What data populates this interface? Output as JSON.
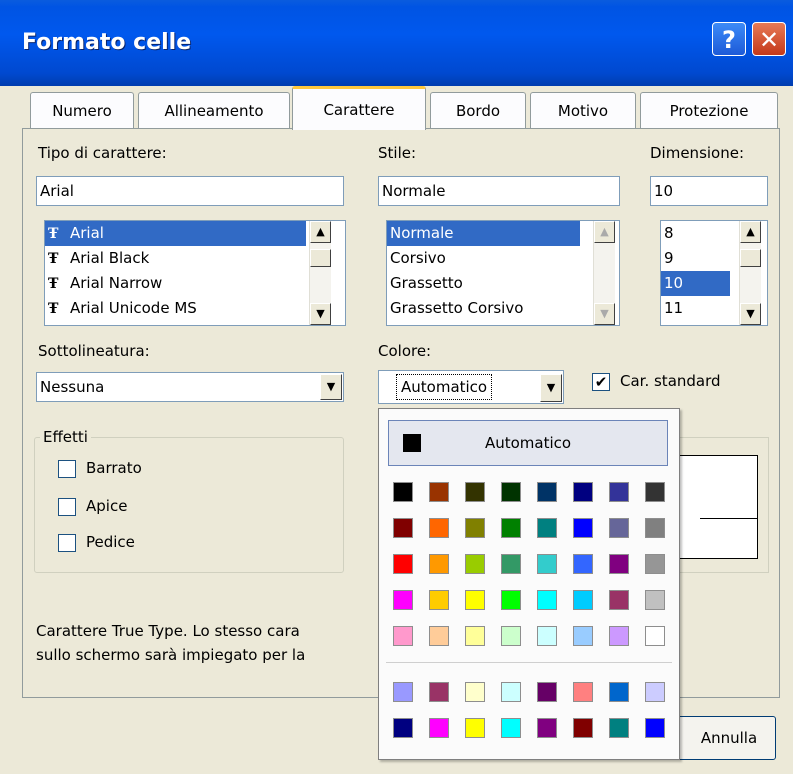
{
  "window": {
    "title": "Formato celle",
    "help_label": "?",
    "close_label": "✕"
  },
  "tabs": [
    {
      "label": "Numero"
    },
    {
      "label": "Allineamento"
    },
    {
      "label": "Carattere"
    },
    {
      "label": "Bordo"
    },
    {
      "label": "Motivo"
    },
    {
      "label": "Protezione"
    }
  ],
  "font": {
    "label": "Tipo di carattere:",
    "value": "Arial",
    "options": [
      "Arial",
      "Arial Black",
      "Arial Narrow",
      "Arial Unicode MS"
    ],
    "selected": "Arial",
    "option_icon": "truetype-icon"
  },
  "style": {
    "label": "Stile:",
    "value": "Normale",
    "options": [
      "Normale",
      "Corsivo",
      "Grassetto",
      "Grassetto Corsivo"
    ],
    "selected": "Normale"
  },
  "size": {
    "label": "Dimensione:",
    "value": "10",
    "options": [
      "8",
      "9",
      "10",
      "11"
    ],
    "selected": "10"
  },
  "underline": {
    "label": "Sottolineatura:",
    "value": "Nessuna"
  },
  "color": {
    "label": "Colore:",
    "value": "Automatico"
  },
  "standard_font": {
    "label": "Car. standard",
    "checked": true
  },
  "effects": {
    "legend": "Effetti",
    "items": [
      {
        "label": "Barrato",
        "checked": false
      },
      {
        "label": "Apice",
        "checked": false
      },
      {
        "label": "Pedice",
        "checked": false
      }
    ]
  },
  "info_text": {
    "line1": "Carattere True Type. Lo stesso cara",
    "line2": "sullo schermo sarà impiegato per la"
  },
  "palette": {
    "auto_label": "Automatico",
    "main_rows": [
      [
        "#000000",
        "#993300",
        "#333300",
        "#003300",
        "#003366",
        "#000080",
        "#333399",
        "#333333"
      ],
      [
        "#800000",
        "#ff6600",
        "#808000",
        "#008000",
        "#008080",
        "#0000ff",
        "#666699",
        "#808080"
      ],
      [
        "#ff0000",
        "#ff9900",
        "#99cc00",
        "#339966",
        "#33cccc",
        "#3366ff",
        "#800080",
        "#969696"
      ],
      [
        "#ff00ff",
        "#ffcc00",
        "#ffff00",
        "#00ff00",
        "#00ffff",
        "#00ccff",
        "#993366",
        "#c0c0c0"
      ],
      [
        "#ff99cc",
        "#ffcc99",
        "#ffff99",
        "#ccffcc",
        "#ccffff",
        "#99ccff",
        "#cc99ff",
        "#ffffff"
      ]
    ],
    "extra_rows": [
      [
        "#9999ff",
        "#993366",
        "#ffffcc",
        "#ccffff",
        "#660066",
        "#ff8080",
        "#0066cc",
        "#ccccff"
      ],
      [
        "#000080",
        "#ff00ff",
        "#ffff00",
        "#00ffff",
        "#800080",
        "#800000",
        "#008080",
        "#0000ff"
      ]
    ]
  },
  "buttons": {
    "cancel_label": "Annulla"
  }
}
